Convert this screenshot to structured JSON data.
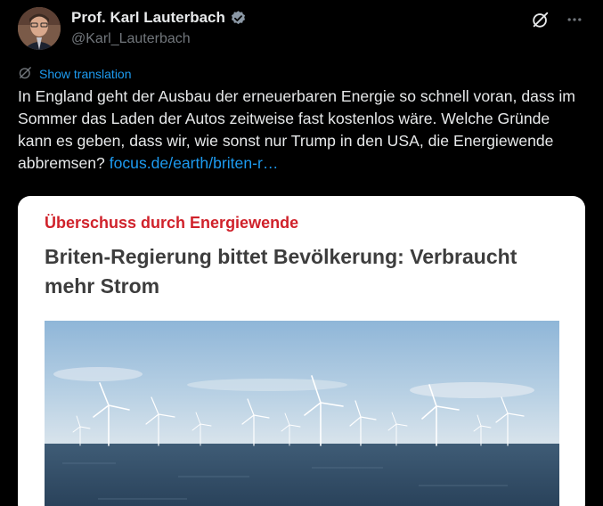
{
  "author": {
    "name": "Prof. Karl Lauterbach",
    "handle": "@Karl_Lauterbach",
    "verified_icon": "verified-badge-icon"
  },
  "actions": {
    "grok_icon": "grok-icon",
    "more_icon": "more-dots-icon"
  },
  "translation": {
    "label": "Show translation"
  },
  "tweet": {
    "text": "In England geht der Ausbau der erneuerbaren Energie so schnell voran, dass im Sommer das Laden der Autos zeitweise fast kostenlos wäre. Welche Gründe kann es geben, dass wir, wie sonst nur Trump in den USA, die Energiewende abbremsen? ",
    "link": "focus.de/earth/briten-r…"
  },
  "card": {
    "kicker": "Überschuss durch Energiewende",
    "headline": "Briten-Regierung bittet Bevölkerung: Verbraucht mehr Strom"
  },
  "colors": {
    "accent": "#1d9bf0",
    "kicker": "#d0222b",
    "verified": "#8b98a5"
  }
}
